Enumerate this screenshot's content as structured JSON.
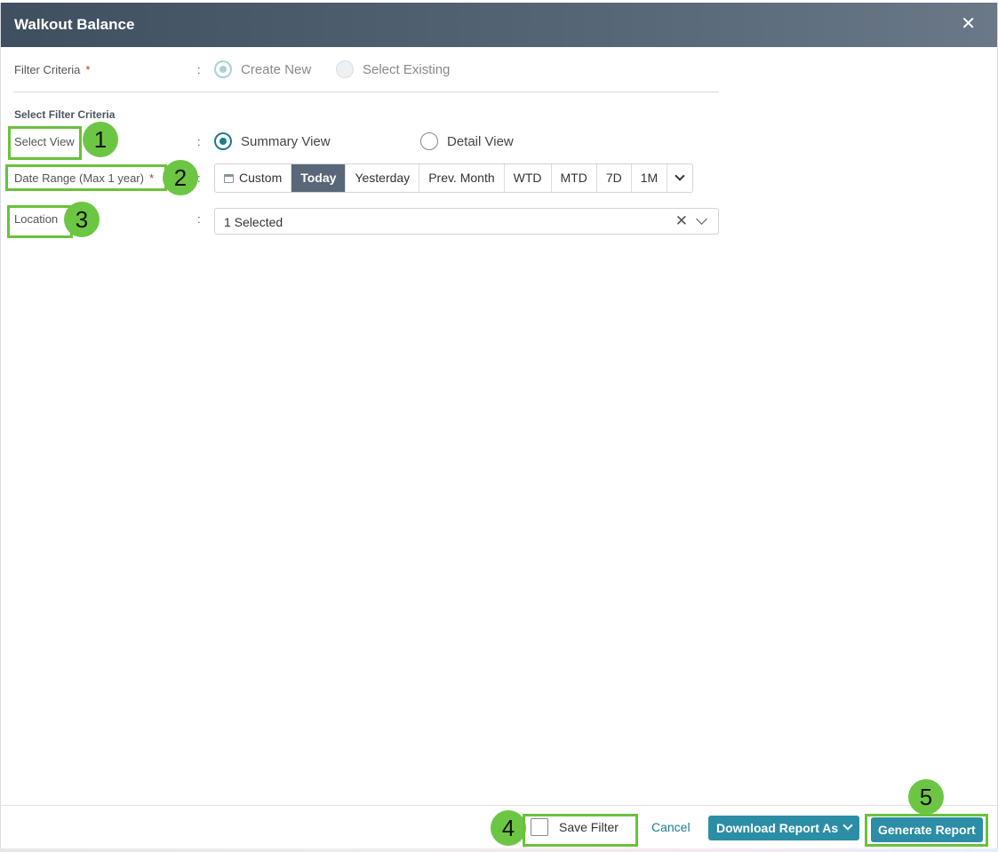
{
  "dialog": {
    "title": "Walkout Balance",
    "close_glyph": "✕"
  },
  "filter_criteria": {
    "label": "Filter Criteria",
    "required_mark": "*",
    "options": [
      "Create New",
      "Select Existing"
    ],
    "selected": "Create New"
  },
  "section_title": "Select Filter Criteria",
  "select_view": {
    "label": "Select View",
    "options": [
      "Summary View",
      "Detail View"
    ],
    "selected": "Summary View"
  },
  "date_range": {
    "label": "Date Range (Max 1 year)",
    "required_mark": "*",
    "options": [
      "Custom",
      "Today",
      "Yesterday",
      "Prev. Month",
      "WTD",
      "MTD",
      "7D",
      "1M"
    ],
    "active": "Today"
  },
  "location": {
    "label": "Location",
    "value": "1 Selected",
    "clear_glyph": "✕"
  },
  "separator": ":",
  "annotations": [
    "1",
    "2",
    "3",
    "4",
    "5"
  ],
  "footer": {
    "save_filter_label": "Save Filter",
    "cancel_label": "Cancel",
    "download_label": "Download Report As",
    "generate_label": "Generate Report"
  },
  "colors": {
    "accent": "#2b8ea6",
    "titlebar": "#4a5a6a",
    "highlight": "#6ac13c",
    "badge": "#6cc644"
  },
  "icons": [
    "close-icon",
    "calendar-icon",
    "chevron-down-icon",
    "clear-icon"
  ]
}
